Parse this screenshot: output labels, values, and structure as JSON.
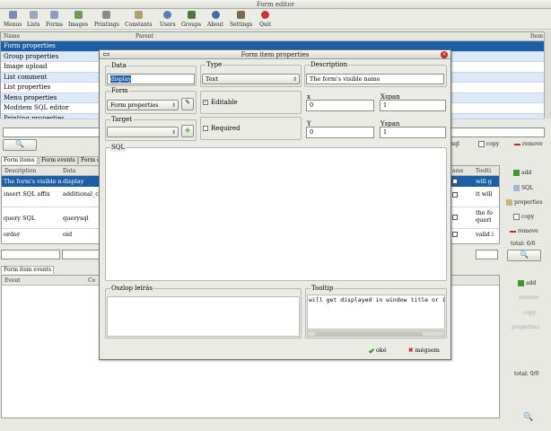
{
  "window": {
    "title": "Form editor"
  },
  "toolbar": {
    "items": [
      "Menus",
      "Lists",
      "Forms",
      "Images",
      "Printings",
      "Constants",
      "Users",
      "Groups",
      "About",
      "Settings",
      "Quit"
    ]
  },
  "top_table": {
    "headers": [
      "Name",
      "Parent",
      "Item"
    ],
    "rows": [
      "Form properties",
      "Group properties",
      "Image upload",
      "List comment",
      "List properties",
      "Menu properties",
      "Moditem SQL editor",
      "Printing properties"
    ]
  },
  "tabs": [
    "Form items",
    "Form events",
    "Form co"
  ],
  "items_table": {
    "headers": [
      "Description",
      "Data",
      "ams",
      "Toolti"
    ],
    "rows": [
      {
        "desc": "The form's visible n",
        "data": "display",
        "tip": "will g"
      },
      {
        "desc": "insert SQL affix",
        "data": "additional_cl",
        "tip": "it will"
      },
      {
        "desc": "query SQL",
        "data": "querysql",
        "tip": "the fo queri"
      },
      {
        "desc": "order",
        "data": "oid",
        "tip": "valid i"
      }
    ]
  },
  "right_panel": {
    "sql_label": "sql",
    "copy": "copy",
    "remove": "remove",
    "add": "add",
    "sql": "SQL",
    "properties": "properties",
    "copy2": "copy",
    "remove2": "remove",
    "total": "total: 6/6",
    "events_add": "add",
    "events_remove": "remove",
    "events_copy": "copy",
    "events_props": "properties",
    "events_total": "total: 0/0"
  },
  "events": {
    "tab": "Form item events",
    "headers": [
      "Event",
      "Co"
    ]
  },
  "dialog": {
    "title": "Form item properties",
    "data_label": "Data",
    "data_value": "display",
    "type_label": "Type",
    "type_value": "Text",
    "description_label": "Description",
    "description_value": "The form's visible name",
    "form_label": "Form",
    "form_value": "Form properties",
    "editable_label": "Editable",
    "x_label": "x",
    "x_value": "0",
    "xspan_label": "Xspan",
    "xspan_value": "1",
    "target_label": "Target",
    "required_label": "Required",
    "y_label": "Y",
    "y_value": "0",
    "yspan_label": "Yspan",
    "yspan_value": "1",
    "sql_label": "SQL",
    "oszlop_label": "Oszlop leírás",
    "tooltip_label": "Tooltip",
    "tooltip_value": "will get displayed in window title or in",
    "ok_label": "oké",
    "cancel_label": "mégsem"
  },
  "colors": {
    "selection": "#1d5fa6",
    "alt_row": "#dde9f6",
    "add_green": "#3a9a2a",
    "remove_red": "#c8281e"
  }
}
